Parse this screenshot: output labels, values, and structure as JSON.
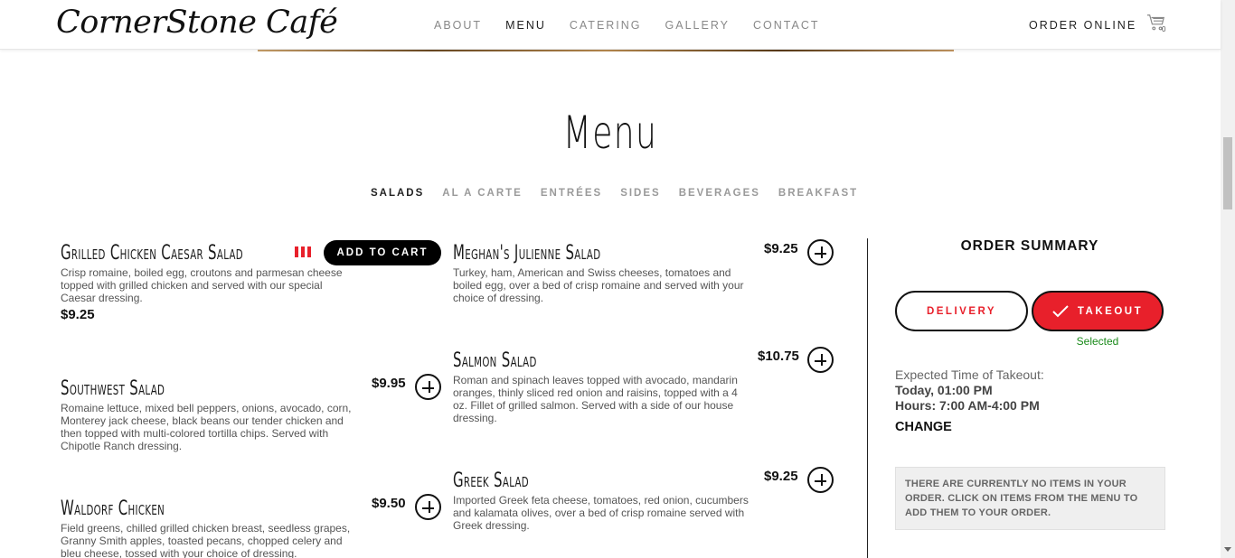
{
  "header": {
    "logo": "CornerStone Café",
    "nav": [
      "ABOUT",
      "MENU",
      "CATERING",
      "GALLERY",
      "CONTACT"
    ],
    "order_online": "ORDER ONLINE",
    "cart_count": "0"
  },
  "menu": {
    "title": "Menu",
    "categories": [
      "SALADS",
      "AL A CARTE",
      "ENTRÉES",
      "SIDES",
      "BEVERAGES",
      "BREAKFAST"
    ],
    "add_to_cart": "ADD TO CART",
    "items": [
      {
        "name": "Grilled Chicken Caesar Salad",
        "desc": "Crisp romaine, boiled egg, croutons and parmesan cheese topped with grilled chicken and served with our special Caesar dressing.",
        "price": "$9.25"
      },
      {
        "name": "Southwest Salad",
        "desc": "Romaine lettuce, mixed bell peppers, onions, avocado, corn, Monterey jack cheese, black beans our tender chicken and then topped with multi-colored tortilla chips. Served with Chipotle Ranch dressing.",
        "price": "$9.95"
      },
      {
        "name": "Waldorf Chicken",
        "desc": "Field greens, chilled grilled chicken breast, seedless grapes, Granny Smith apples, toasted pecans, chopped celery and bleu cheese, tossed with your choice of dressing.",
        "price": "$9.50"
      },
      {
        "name": "Meghan's Julienne Salad",
        "desc": "Turkey, ham, American and Swiss cheeses, tomatoes and boiled egg, over a bed of crisp romaine and served with your choice of dressing.",
        "price": "$9.25"
      },
      {
        "name": "Salmon Salad",
        "desc": "Roman and spinach leaves topped with avocado, mandarin oranges, thinly sliced red onion and raisins, topped with a 4 oz. Fillet of grilled salmon. Served with a side of our house dressing.",
        "price": "$10.75"
      },
      {
        "name": "Greek Salad",
        "desc": "Imported Greek feta cheese, tomatoes, red onion, cucumbers and kalamata olives, over a bed of crisp romaine served with Greek dressing.",
        "price": "$9.25"
      }
    ]
  },
  "order_summary": {
    "title": "ORDER SUMMARY",
    "delivery": "DELIVERY",
    "takeout": "TAKEOUT",
    "selected": "Selected",
    "expected_label": "Expected Time of Takeout:",
    "expected_time": "Today, 01:00 PM",
    "hours": "Hours: 7:00 AM-4:00 PM",
    "change": "CHANGE",
    "empty_message": "THERE ARE CURRENTLY NO ITEMS IN YOUR ORDER. CLICK ON ITEMS FROM THE MENU TO ADD THEM TO YOUR ORDER."
  },
  "colors": {
    "accent": "#e8202b",
    "selected_green": "#1a8a1a"
  }
}
